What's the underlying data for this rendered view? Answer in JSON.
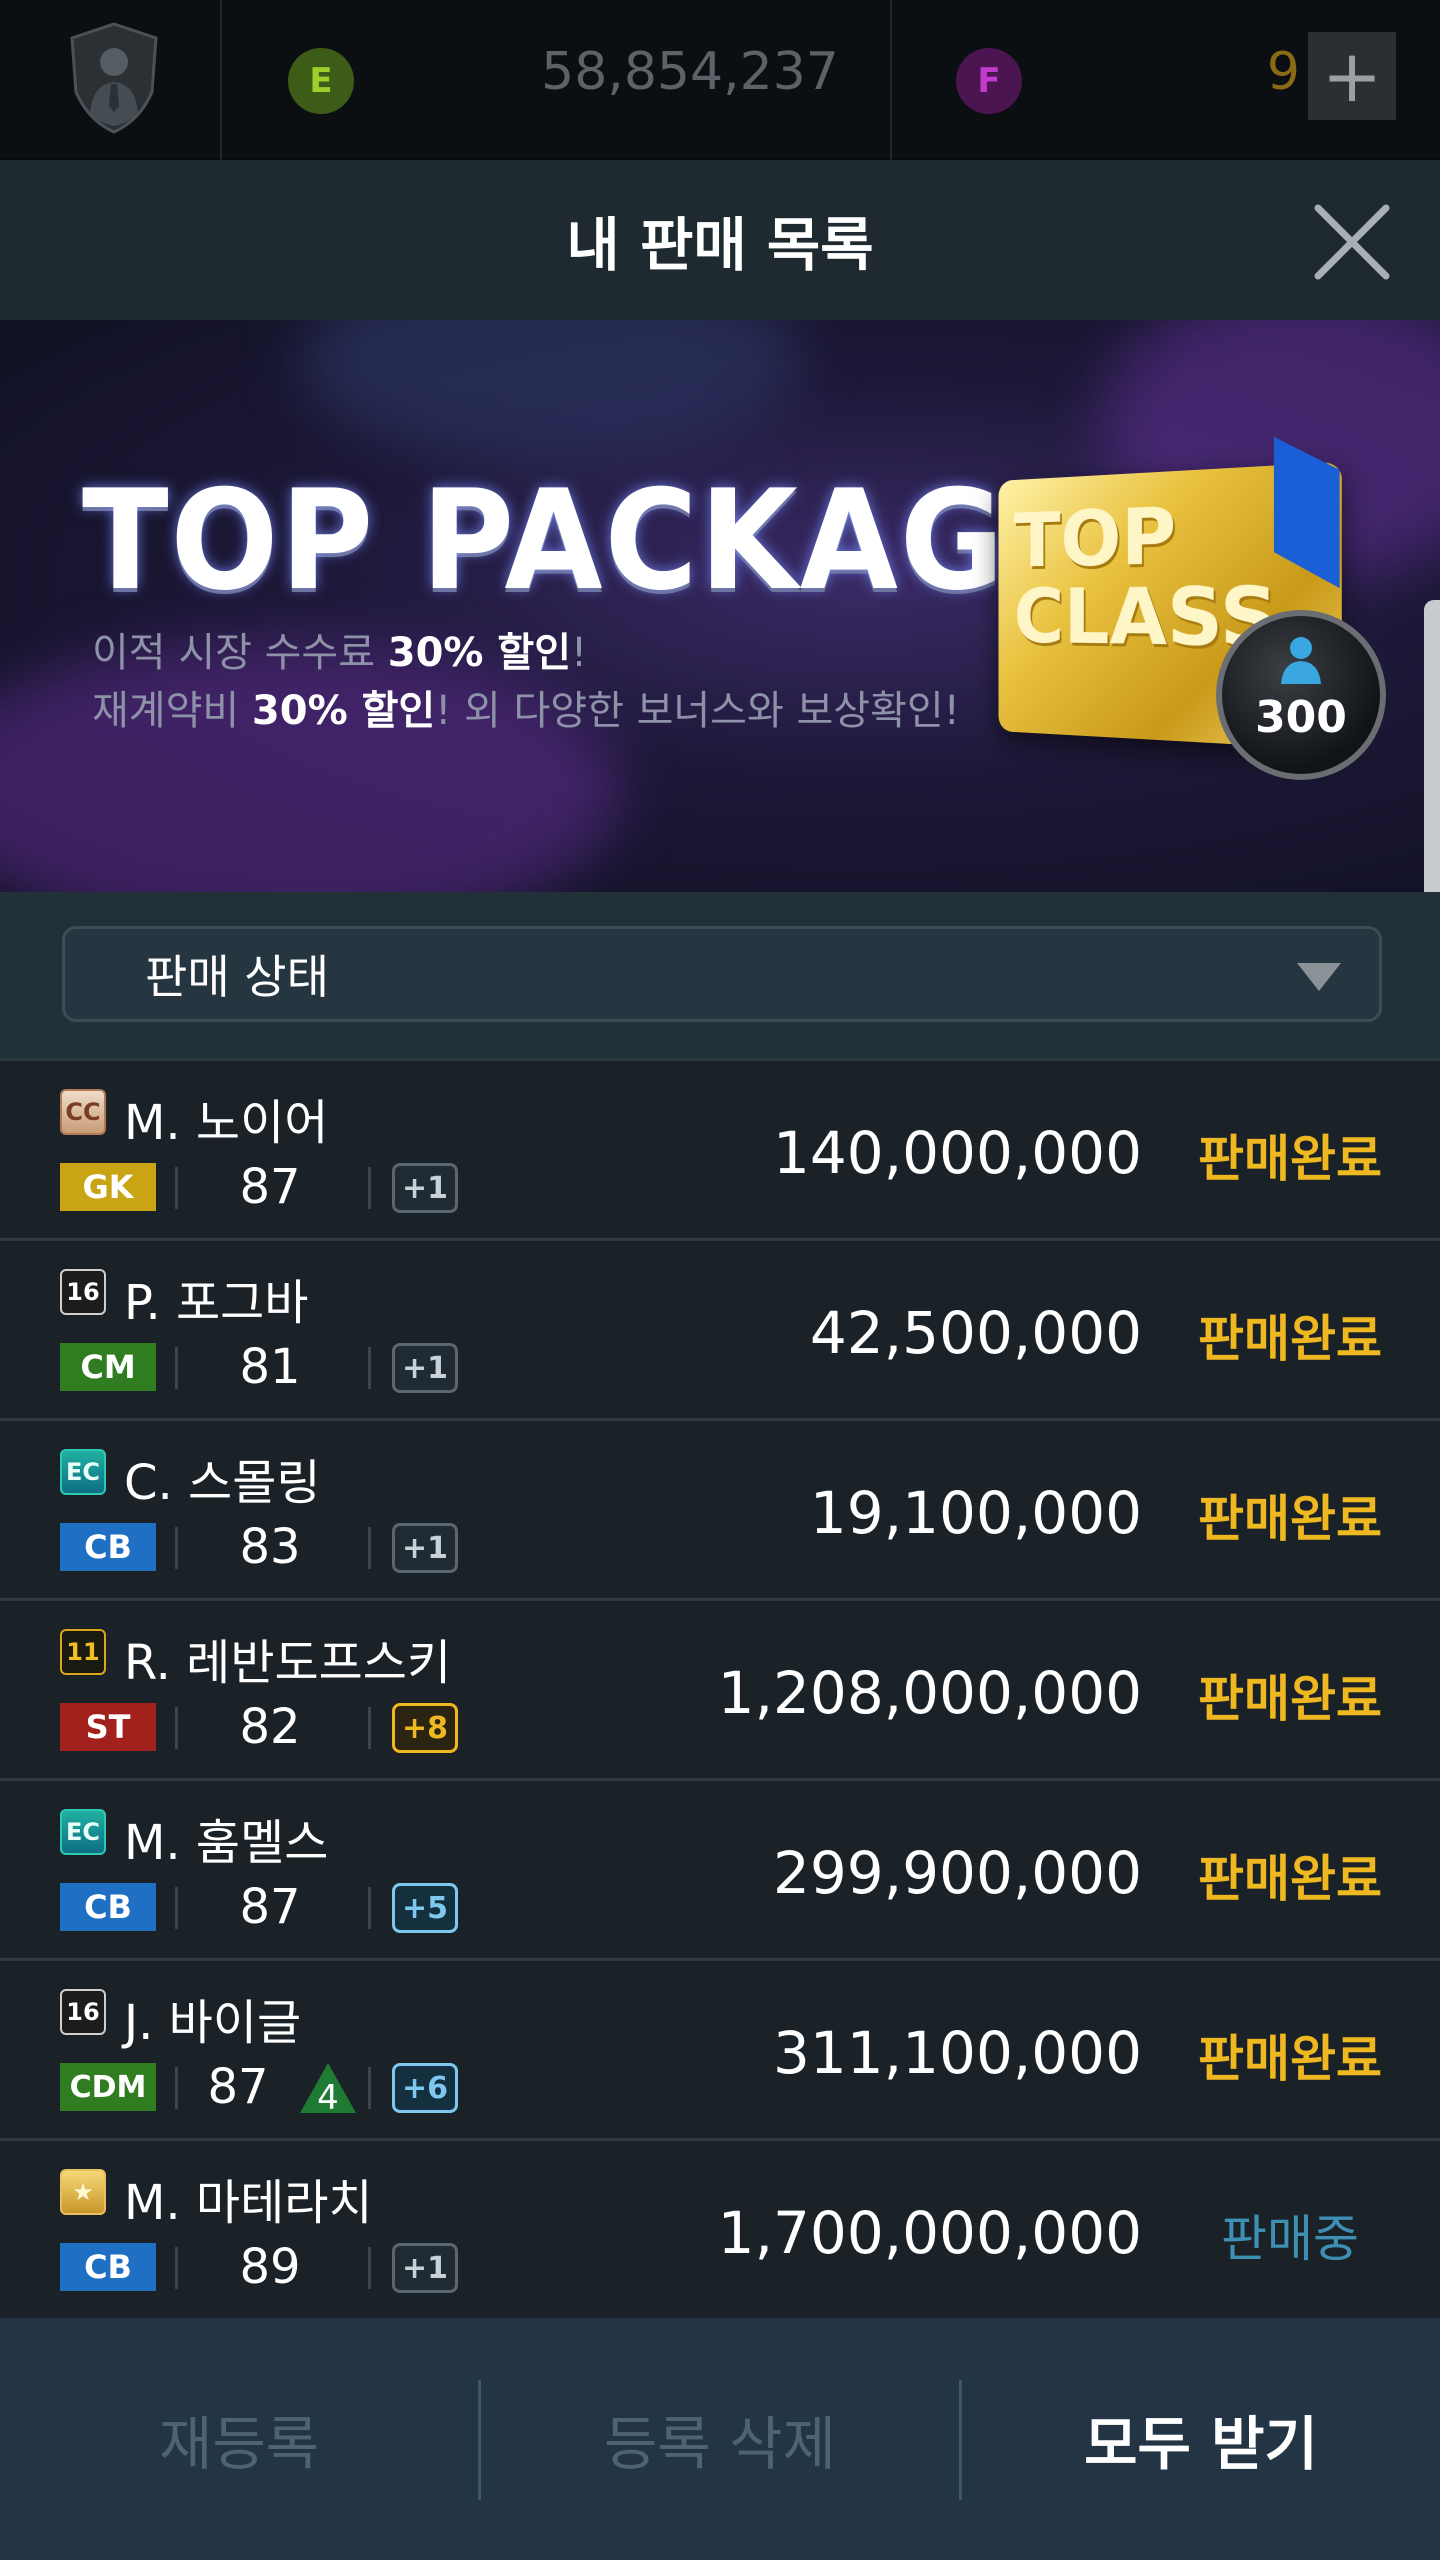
{
  "currency": {
    "e_icon": "E",
    "e_amount": "58,854,237",
    "f_icon": "F",
    "f_amount": "9",
    "plus_label": "+"
  },
  "header": {
    "title": "내 판매 목록"
  },
  "banner": {
    "title": "TOP PACKAGE",
    "line1_pre": "이적 시장 수수료 ",
    "line1_bold": "30% 할인",
    "line1_post": "!",
    "line2_pre": "재계약비 ",
    "line2_bold": "30% 할인",
    "line2_post": "! 외 다양한 보너스와 보상확인!",
    "card_text_1": "TOP",
    "card_text_2": "CLASS",
    "badge_number": "300"
  },
  "filter": {
    "label": "판매 상태"
  },
  "colors": {
    "status_done": "#f0b820",
    "status_selling": "#3e8fb4",
    "pos_gk": "#c9a414",
    "pos_cm": "#2f7d20",
    "pos_cb": "#1f6fc4",
    "pos_st": "#a3211c",
    "pos_cdm": "#2f7d20"
  },
  "rows": [
    {
      "season": "CC",
      "season_style": "cc",
      "name": "M. 노이어",
      "pos": "GK",
      "ovr": "87",
      "enh": "+1",
      "enh_style": "grey",
      "price": "140,000,000",
      "status": "판매완료",
      "status_style": "done"
    },
    {
      "season": "16",
      "season_style": "s16",
      "name": "P. 포그바",
      "pos": "CM",
      "ovr": "81",
      "enh": "+1",
      "enh_style": "grey",
      "price": "42,500,000",
      "status": "판매완료",
      "status_style": "done"
    },
    {
      "season": "EC",
      "season_style": "ec",
      "name": "C. 스몰링",
      "pos": "CB",
      "ovr": "83",
      "enh": "+1",
      "enh_style": "grey",
      "price": "19,100,000",
      "status": "판매완료",
      "status_style": "done"
    },
    {
      "season": "11",
      "season_style": "s11",
      "name": "R. 레반도프스키",
      "pos": "ST",
      "ovr": "82",
      "enh": "+8",
      "enh_style": "gold",
      "price": "1,208,000,000",
      "status": "판매완료",
      "status_style": "done"
    },
    {
      "season": "EC",
      "season_style": "ec",
      "name": "M. 훔멜스",
      "pos": "CB",
      "ovr": "87",
      "enh": "+5",
      "enh_style": "blue",
      "price": "299,900,000",
      "status": "판매완료",
      "status_style": "done"
    },
    {
      "season": "16",
      "season_style": "s16",
      "name": "J. 바이글",
      "pos": "CDM",
      "ovr": "87",
      "trend": "4",
      "enh": "+6",
      "enh_style": "blue",
      "price": "311,100,000",
      "status": "판매완료",
      "status_style": "done"
    },
    {
      "season": "★",
      "season_style": "star",
      "name": "M. 마테라치",
      "pos": "CB",
      "ovr": "89",
      "enh": "+1",
      "enh_style": "grey",
      "price": "1,700,000,000",
      "status": "판매중",
      "status_style": "selling"
    }
  ],
  "actions": {
    "relist": "재등록",
    "delete": "등록 삭제",
    "receive_all": "모두 받기"
  },
  "icons": {
    "avatar": "manager-shield-icon",
    "close": "close-icon",
    "dropdown": "caret-down-icon",
    "trend": "up-triangle-icon"
  }
}
